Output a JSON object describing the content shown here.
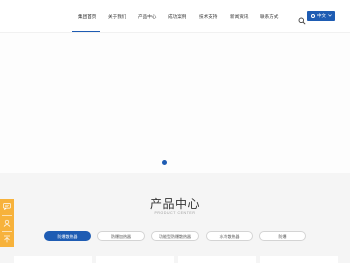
{
  "nav": {
    "items": [
      {
        "label": "集团首页"
      },
      {
        "label": "关于我们"
      },
      {
        "label": "产品中心"
      },
      {
        "label": "成功案例"
      },
      {
        "label": "技术支持"
      },
      {
        "label": "新闻资讯"
      },
      {
        "label": "联系方式"
      }
    ],
    "active_index": 0,
    "lang_label": "中文"
  },
  "products": {
    "title": "产品中心",
    "subtitle": "PRODUCT CENTER",
    "tabs": [
      {
        "label": "防爆散热器"
      },
      {
        "label": "防爆加热器"
      },
      {
        "label": "功能型防爆散热器"
      },
      {
        "label": "水冷散热器"
      },
      {
        "label": "防爆"
      }
    ],
    "active_tab": 0
  },
  "colors": {
    "accent": "#1e5cb3",
    "side_bar": "#f7b23b"
  }
}
